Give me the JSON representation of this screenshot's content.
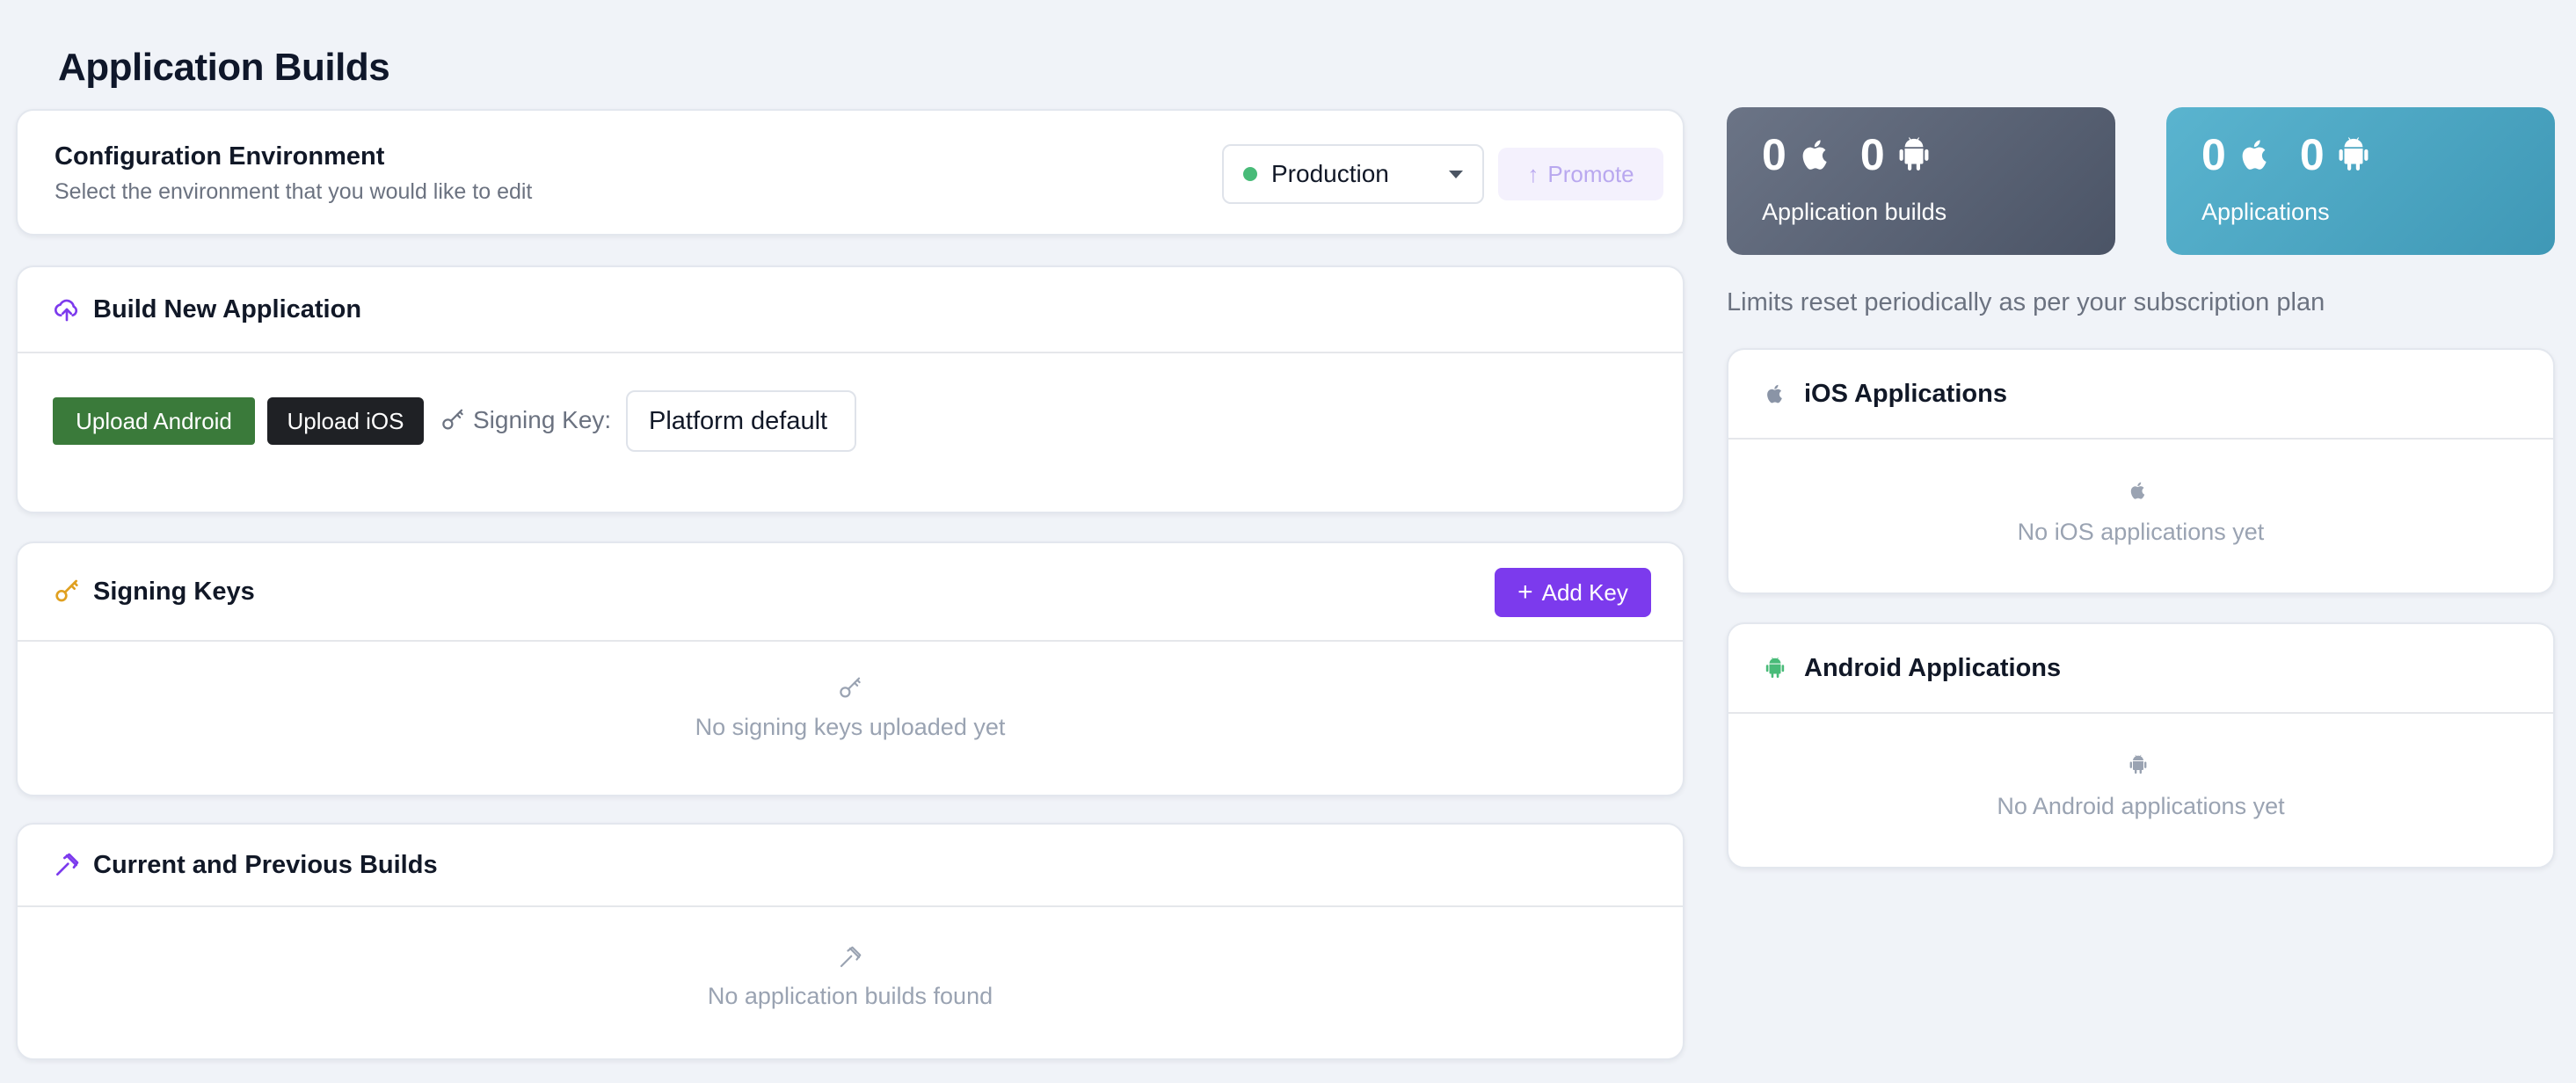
{
  "page": {
    "title": "Application Builds"
  },
  "env": {
    "title": "Configuration Environment",
    "subtitle": "Select the environment that you would like to edit",
    "selected": "Production",
    "promote_label": "Promote"
  },
  "build": {
    "title": "Build New Application",
    "upload_android": "Upload Android",
    "upload_ios": "Upload iOS",
    "signing_key_label": "Signing Key:",
    "signing_key_value": "Platform default"
  },
  "keys": {
    "title": "Signing Keys",
    "add_label": "Add Key",
    "empty": "No signing keys uploaded yet"
  },
  "builds": {
    "title": "Current and Previous Builds",
    "empty": "No application builds found"
  },
  "stats": {
    "builds": {
      "ios": "0",
      "android": "0",
      "label": "Application builds"
    },
    "apps": {
      "ios": "0",
      "android": "0",
      "label": "Applications"
    }
  },
  "limits_note": "Limits reset periodically as per your subscription plan",
  "ios_apps": {
    "title": "iOS Applications",
    "empty": "No iOS applications yet"
  },
  "android_apps": {
    "title": "Android Applications",
    "empty": "No Android applications yet"
  },
  "colors": {
    "accent": "#7c3aed",
    "android_button": "#3a7a3a",
    "ios_button": "#1f2125",
    "status_dot": "#48bb78"
  }
}
